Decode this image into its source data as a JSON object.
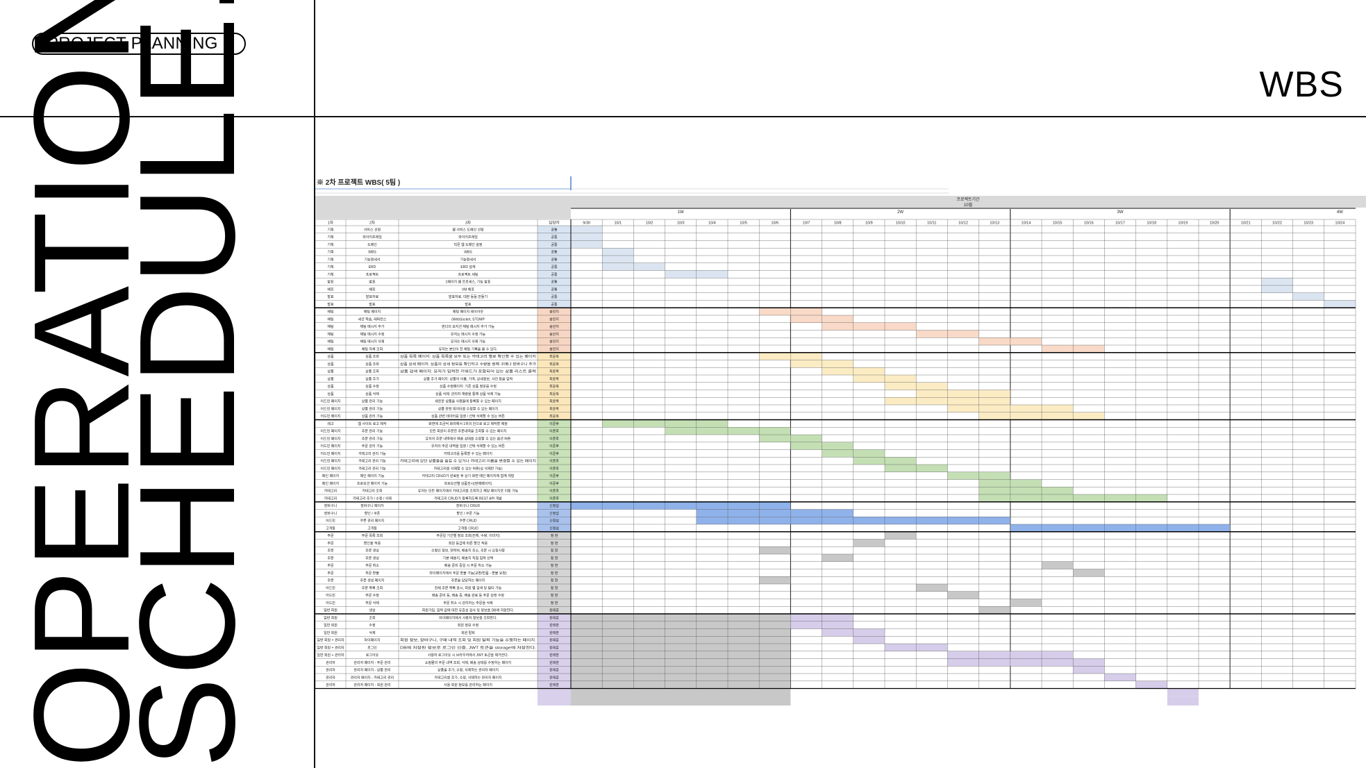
{
  "header": {
    "tag_label": "PROJECT PLANNING",
    "section_title": "WBS"
  },
  "side_title": {
    "line1": "OPERATION",
    "line2": "SCHEDULE."
  },
  "sheet": {
    "title": "※ 2차 프로젝트 WBS( 5팀 )",
    "period_label": "프로젝트기간",
    "month_label": "10월",
    "col_headers": [
      "1차",
      "2차",
      "3차",
      "담당자"
    ],
    "weeks": [
      "1W",
      "2W",
      "3W",
      "4W"
    ],
    "dates": [
      "9/30",
      "10/1",
      "10/2",
      "10/3",
      "10/4",
      "10/5",
      "10/6",
      "10/7",
      "10/8",
      "10/9",
      "10/10",
      "10/11",
      "10/12",
      "10/13",
      "10/14",
      "10/15",
      "10/16",
      "10/17",
      "10/18",
      "10/19",
      "10/20",
      "10/21",
      "10/22",
      "10/23",
      "10/24"
    ],
    "rows": [
      {
        "c1": "기획",
        "c2": "서비스 선정",
        "c3": "웹 서비스 도메인 선정",
        "who": "공통"
      },
      {
        "c1": "기획",
        "c2": "와이어프레임",
        "c3": "와이어프레임",
        "who": "공통"
      },
      {
        "c1": "기획",
        "c2": "도메인",
        "c3": "빅픈 웹 도메인 설정",
        "who": "공통"
      },
      {
        "c1": "기획",
        "c2": "WBS",
        "c3": "WBS",
        "who": "공통"
      },
      {
        "c1": "기획",
        "c2": "기능명세서",
        "c3": "기능명세서",
        "who": "공통"
      },
      {
        "c1": "기획",
        "c2": "ERD",
        "c3": "ERD 설계",
        "who": "공통"
      },
      {
        "c1": "기획",
        "c2": "프로젝트",
        "c3": "프로젝트 세팅",
        "who": "공통"
      },
      {
        "c1": "발표",
        "c2": "발표",
        "c3": "1페이지 웹 프로세스, 기능 발표",
        "who": "공통"
      },
      {
        "c1": "배포",
        "c2": "배포",
        "c3": "VM 배포",
        "who": "공통"
      },
      {
        "c1": "발표",
        "c2": "발표자료",
        "c3": "발표자료, 대본 등등 만들기",
        "who": "공통"
      },
      {
        "c1": "발표",
        "c2": "발표",
        "c3": "발표",
        "who": "공통"
      },
      {
        "c1": "채팅",
        "c2": "채팅 페이지",
        "c3": "채팅 페이지 레이아웃",
        "who": "송민지"
      },
      {
        "c1": "채팅",
        "c2": "세션 학습, 레퍼런스",
        "c3": "(WebSocket, STOMP",
        "who": "송민지"
      },
      {
        "c1": "채팅",
        "c2": "채팅 메시지 추가",
        "c3": "판다의 포지션 채팅 메시지 추가 가능",
        "who": "송민지"
      },
      {
        "c1": "채팅",
        "c2": "채팅 메시지 수정",
        "c3": "유저는 메시지 수정 가능",
        "who": "송민지"
      },
      {
        "c1": "채팅",
        "c2": "채팅 메시지 삭제",
        "c3": "유저는 메시지 삭제 가능",
        "who": "송민지"
      },
      {
        "c1": "채팅",
        "c2": "채팅 자체 조회",
        "c3": "유저는 본인이 한 채팅 기록을 볼 수 있다.",
        "who": "송민지"
      },
      {
        "c1": "상품",
        "c2": "상품 조회",
        "c3": "상품 목록 페이지: 상품 목록을 모두 또는 카테고리 별로 확인할 수 있는 페이지",
        "who": "최윤복"
      },
      {
        "c1": "상품",
        "c2": "상품 조회",
        "c3": "상품 상세 페이지: 상품의 상세 정보를 확인하고 수량을 정해 구매나 장바구니 추가",
        "who": "최윤복"
      },
      {
        "c1": "상품",
        "c2": "상품 조회",
        "c3": "상품 검색 페이지: 유저가 입력한 키워드가 포함되어 있는 상품 리스트 출력",
        "who": "최윤복"
      },
      {
        "c1": "상품",
        "c2": "상품 추가",
        "c3": "상품 추가 페이지: 상품의 이름, 가격, 상세정보, 사진 등을 입력",
        "who": "최윤복"
      },
      {
        "c1": "상품",
        "c2": "상품 수정",
        "c3": "상품 수정페이지: 기존 상품 정보를 수정",
        "who": "최윤복"
      },
      {
        "c1": "상품",
        "c2": "상품 삭제",
        "c3": "상품 삭제: 관리자 재량을 통해 상품 삭제 가능",
        "who": "최윤복"
      },
      {
        "c1": "어드민 페이지",
        "c2": "상품 관리 기능",
        "c3": "새로운 상품을 사용들에 등록할 수 있는 페이지",
        "who": "최윤복"
      },
      {
        "c1": "어드민 페이지",
        "c2": "상품 관리 기능",
        "c3": "상품 관련 데이터를 수정할 수 있는 페이지",
        "who": "최윤복"
      },
      {
        "c1": "어드민 페이지",
        "c2": "상품 관리 기능",
        "c3": "상품 관련 데이터를 일괄 / 선택 삭제할 수 있는 버튼",
        "who": "최윤복"
      },
      {
        "c1": "레고",
        "c2": "웹 사이트 로고 제작",
        "c3": "화면에 조금씩 화려해서 1위의 안으로 로고 제작할 예정",
        "who": "이준후"
      },
      {
        "c1": "어드민 페이지",
        "c2": "주문 관리 기능",
        "c3": "모든 회원이 주문한 주문내역을 조회할 수 있는 페이지",
        "who": "이준후"
      },
      {
        "c1": "어드민 페이지",
        "c2": "주문 관리 기능",
        "c3": "유저의 주문 내역에서 배송 상태를 수정할 수 있는 옵션 버튼",
        "who": "이준후"
      },
      {
        "c1": "어드민 페이지",
        "c2": "주문 관리 기능",
        "c3": "유저의 주문 내역을 일괄 / 선택 삭제할 수 있는 버튼",
        "who": "이준후"
      },
      {
        "c1": "어드민 페이지",
        "c2": "카테고리 관리 기능",
        "c3": "카테고리를 등록할 수 있는 페이지",
        "who": "이준후"
      },
      {
        "c1": "어드민 페이지",
        "c2": "카테고리 관리 기능",
        "c3": "카테고리에 있던 상품들을 옮길 수 있거나 카테고리 이름을 변경할 수 있는 페이지",
        "who": "이준후"
      },
      {
        "c1": "어드민 페이지",
        "c2": "카테고리 관리 기능",
        "c3": "카테고리를 삭제할 수 있는 버튼(상 삭제만 가능)",
        "who": "이준후"
      },
      {
        "c1": "메인 페이지",
        "c2": "메인 페이지 기능",
        "c3": "카테고리 CRUD가 완료된 후 상기 화면 메인 페이지에 함께 개발",
        "who": "이준후"
      },
      {
        "c1": "메인 페이지",
        "c2": "프로모션 페이지 기능",
        "c3": "프로모션별 상품전시(판매페이지)",
        "who": "이준후"
      },
      {
        "c1": "카테고리",
        "c2": "카테고리 조회",
        "c3": "유저는 모든 페이지에서 카테고리를 조회하고 해당 페이지로 이동 가능",
        "who": "이준후"
      },
      {
        "c1": "카테고리",
        "c2": "카테고리 추가 / 수정 / 삭제",
        "c3": "카테고리 CRUD가 등록하도록 REST API 개발",
        "who": "이준후"
      },
      {
        "c1": "장바구니",
        "c2": "장바구니 페이지",
        "c3": "장바구니 CRUD",
        "who": "신정섭"
      },
      {
        "c1": "장바구니",
        "c2": "할인 / 쿠폰",
        "c3": "할인 / 쿠폰 기능",
        "who": "신정섭"
      },
      {
        "c1": "어드민",
        "c2": "쿠폰 관리 페이지",
        "c3": "쿠폰 CRUD",
        "who": "신정섭"
      },
      {
        "c1": "고객등",
        "c2": "고객등",
        "c3": "고객등 CRUD",
        "who": "신정섭"
      },
      {
        "c1": "주문",
        "c2": "주문 목록 조회",
        "c3": "주문일 기간별 정보 조회(전체, 수량, 이미지)",
        "who": "정 현"
      },
      {
        "c1": "주문",
        "c2": "할인율 적용",
        "c3": "회원 등급에 따른 할인 적용",
        "who": "정 현"
      },
      {
        "c1": "주문",
        "c2": "주문 생성",
        "c3": "수령인 정보, 연락처, 배송지 주소, 주문 시 요청사항",
        "who": "정 현"
      },
      {
        "c1": "주문",
        "c2": "주문 생성",
        "c3": "기본 배송지, 배송지 직접 입력 선택",
        "who": "정 현"
      },
      {
        "c1": "주문",
        "c2": "주문 취소",
        "c3": "배송 준비 중일 시 주문 취소 가능",
        "who": "정 현"
      },
      {
        "c1": "주문",
        "c2": "주문 환불",
        "c3": "마이페이지에서 주문 환불 가능(교환/반품 - 환불 요청)",
        "who": "정 현"
      },
      {
        "c1": "주문",
        "c2": "주문 생성 페이지",
        "c3": "주문을 담당하는 페이지",
        "who": "정 현"
      },
      {
        "c1": "어드민",
        "c2": "주문 목록 조회",
        "c3": "전체 주문 목록 표시, 회원 별 검색 및 필터 가능",
        "who": "정 현"
      },
      {
        "c1": "어드민",
        "c2": "주문 수정",
        "c3": "배송 준비 등, 배송 중, 배송 완료 등 주문 상태 수정",
        "who": "정 현"
      },
      {
        "c1": "어드민",
        "c2": "주문 삭제",
        "c3": "주문 취소 시 관리자는 주문을 삭제",
        "who": "정 현"
      },
      {
        "c1": "일반 회원",
        "c2": "생성",
        "c3": "회원가입, 입력 값에 대한 유효성 검사 및 정보를 DB에 저장한다.",
        "who": "원태훈"
      },
      {
        "c1": "일반 회원",
        "c2": "조회",
        "c3": "마이페이지에서 사용자 정보를 조회한다.",
        "who": "원태훈"
      },
      {
        "c1": "일반 회원",
        "c2": "수정",
        "c3": "회원 정보 수정",
        "who": "원태훈"
      },
      {
        "c1": "일반 회원",
        "c2": "삭제",
        "c3": "회원 탈퇴",
        "who": "원태훈"
      },
      {
        "c1": "일반 회원 + 관리자",
        "c2": "마이페이지",
        "c3": "회원 정보, 장바구니, 구매 내역 조회 및 회원 탈퇴 기능을 수행하는 페이지.",
        "who": "원태훈"
      },
      {
        "c1": "일반 회원 + 관리자",
        "c2": "로그인",
        "c3": "DB에 저장된 정보로 로그인 인증, JWT 토큰을 storage에 저장한다.",
        "who": "원태훈"
      },
      {
        "c1": "일반 회원 + 관리자",
        "c2": "로그아웃",
        "c3": "사용자 로그아웃 시 브라우저에서 JWT 토큰을 제거한다.",
        "who": "원태훈"
      },
      {
        "c1": "관리자",
        "c2": "관리자 페이지 - 주문 관리",
        "c3": "쇼핑몰의 주문 내역 조회, 삭제, 배송 상태를 수정하는 페이지",
        "who": "원태훈"
      },
      {
        "c1": "관리자",
        "c2": "관리자 페이지 - 상품 관리",
        "c3": "상품을 추가, 수정, 삭제하는 관리자 페이지",
        "who": "원태훈"
      },
      {
        "c1": "관리자",
        "c2": "관리자 페이지 - 카테고리 관리",
        "c3": "카테고리를 추가, 수정, 삭제하는 관리자 페이지",
        "who": "원태훈"
      },
      {
        "c1": "관리자",
        "c2": "관리자 페이지 - 회원 관리",
        "c3": "사용 회원 정보를 관리하는 페이지",
        "who": "원태훈"
      }
    ],
    "groups": [
      {
        "name": "공통",
        "start": 0,
        "count": 11,
        "color": "#dbe5f1",
        "who_bg": "#d9e4f3"
      },
      {
        "name": "송민지",
        "start": 11,
        "count": 6,
        "color": "#f9d9c7",
        "who_bg": "#f7d6c4"
      },
      {
        "name": "최윤복",
        "start": 17,
        "count": 9,
        "color": "#fbecc4",
        "who_bg": "#fbe7bb"
      },
      {
        "name": "이준후",
        "start": 26,
        "count": 11,
        "color": "#c4dfb4",
        "who_bg": "#c9e2b9"
      },
      {
        "name": "신정섭",
        "start": 37,
        "count": 4,
        "color": "#8fb2ea",
        "who_bg": "#a9c2ed"
      },
      {
        "name": "정 현",
        "start": 41,
        "count": 11,
        "color": "#c8c8c8",
        "who_bg": "#d4d4d4"
      },
      {
        "name": "원태훈",
        "start": 52,
        "count": 13,
        "color": "#d6cdea",
        "who_bg": "#d9d0ec"
      }
    ],
    "bars": [
      [
        0,
        0,
        0
      ],
      [
        1,
        0,
        0
      ],
      [
        2,
        0,
        0
      ],
      [
        3,
        1,
        1
      ],
      [
        4,
        1,
        1
      ],
      [
        5,
        1,
        2
      ],
      [
        6,
        3,
        4
      ],
      [
        7,
        22,
        22
      ],
      [
        8,
        22,
        22
      ],
      [
        9,
        23,
        23
      ],
      [
        10,
        24,
        24
      ],
      [
        11,
        6,
        7
      ],
      [
        12,
        7,
        8
      ],
      [
        13,
        8,
        10
      ],
      [
        14,
        11,
        12
      ],
      [
        15,
        13,
        14
      ],
      [
        16,
        15,
        16
      ],
      [
        17,
        6,
        7
      ],
      [
        18,
        7,
        8
      ],
      [
        19,
        8,
        9
      ],
      [
        20,
        9,
        10
      ],
      [
        21,
        10,
        11
      ],
      [
        22,
        11,
        13
      ],
      [
        23,
        10,
        13
      ],
      [
        24,
        12,
        15
      ],
      [
        25,
        13,
        16
      ],
      [
        26,
        1,
        4
      ],
      [
        27,
        3,
        6
      ],
      [
        28,
        6,
        7
      ],
      [
        29,
        7,
        8
      ],
      [
        30,
        8,
        9
      ],
      [
        31,
        9,
        10
      ],
      [
        32,
        10,
        11
      ],
      [
        33,
        12,
        13
      ],
      [
        34,
        13,
        14
      ],
      [
        35,
        13,
        15
      ],
      [
        36,
        13,
        18
      ],
      [
        37,
        0,
        6
      ],
      [
        38,
        4,
        8
      ],
      [
        39,
        4,
        13
      ],
      [
        40,
        14,
        20
      ],
      [
        41,
        10,
        10
      ],
      [
        42,
        9,
        9
      ],
      [
        43,
        6,
        6
      ],
      [
        44,
        8,
        8
      ],
      [
        45,
        15,
        15
      ],
      [
        46,
        16,
        16
      ],
      [
        47,
        6,
        6
      ],
      [
        48,
        11,
        11
      ],
      [
        49,
        12,
        12
      ],
      [
        50,
        14,
        14
      ],
      [
        51,
        13,
        13
      ],
      [
        52,
        7,
        8
      ],
      [
        53,
        7,
        8
      ],
      [
        54,
        8,
        9
      ],
      [
        55,
        9,
        9
      ],
      [
        56,
        10,
        11
      ],
      [
        57,
        12,
        15
      ],
      [
        58,
        12,
        16
      ],
      [
        59,
        16,
        16
      ],
      [
        60,
        17,
        17
      ],
      [
        61,
        18,
        18
      ],
      [
        62,
        19,
        19
      ],
      [
        63,
        19,
        19
      ],
      [
        64,
        19,
        19
      ]
    ],
    "shade_block": {
      "from_row": 52,
      "to_row": 64,
      "from_col": 0,
      "to_col": 6,
      "color": "#c8c8c8"
    }
  }
}
